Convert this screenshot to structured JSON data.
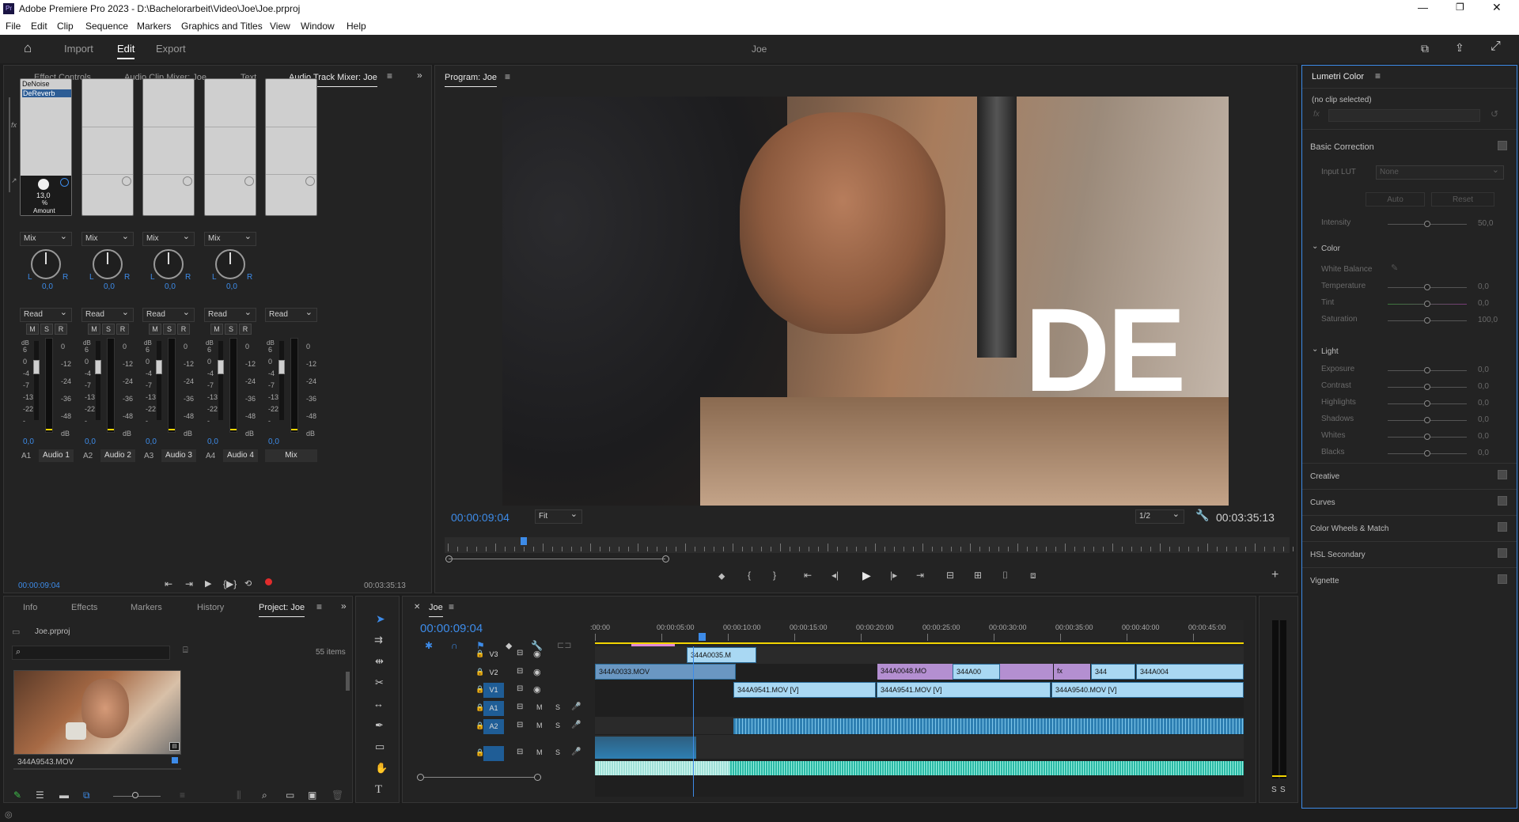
{
  "window": {
    "title": "Adobe Premiere Pro 2023 - D:\\Bachelorarbeit\\Video\\Joe\\Joe.prproj"
  },
  "menu": [
    "File",
    "Edit",
    "Clip",
    "Sequence",
    "Markers",
    "Graphics and Titles",
    "View",
    "Window",
    "Help"
  ],
  "workspace": {
    "tabs": [
      "Import",
      "Edit",
      "Export"
    ],
    "active": "Edit",
    "project_name": "Joe"
  },
  "left_panel": {
    "tabs": [
      "Effect Controls",
      "Audio Clip Mixer: Joe",
      "Text",
      "Audio Track Mixer: Joe"
    ],
    "active": "Audio Track Mixer: Joe"
  },
  "mixer": {
    "effects": [
      "DeNoise",
      "DeReverb"
    ],
    "amount_value": "13,0",
    "amount_unit": "%",
    "amount_label": "Amount",
    "mode_label": "Mix",
    "automation_label": "Read",
    "mute": "M",
    "solo": "S",
    "record": "R",
    "db_label": "dB",
    "left_scale": [
      "6",
      "0",
      "-4",
      "-7",
      "-13",
      "-22",
      "-"
    ],
    "right_scale": [
      "0",
      "-12",
      "-24",
      "-36",
      "-48",
      "dB"
    ],
    "channels": [
      {
        "id": "A1",
        "name": "Audio 1",
        "pan": "0,0",
        "vol": "0,0"
      },
      {
        "id": "A2",
        "name": "Audio 2",
        "pan": "0,0",
        "vol": "0,0"
      },
      {
        "id": "A3",
        "name": "Audio 3",
        "pan": "0,0",
        "vol": "0,0"
      },
      {
        "id": "A4",
        "name": "Audio 4",
        "pan": "0,0",
        "vol": "0,0"
      },
      {
        "id": "",
        "name": "Mix",
        "pan": "",
        "vol": "0,0"
      }
    ],
    "pan_l": "L",
    "pan_r": "R",
    "current_time": "00:00:09:04",
    "duration": "00:03:35:13"
  },
  "program": {
    "title": "Program: Joe",
    "timecode": "00:00:09:04",
    "fit": "Fit",
    "resolution": "1/2",
    "duration": "00:03:35:13",
    "overlay_text": "DE",
    "playhead_fraction": 0.09
  },
  "lumetri": {
    "title": "Lumetri Color",
    "no_clip": "(no clip selected)",
    "fx": "fx",
    "basic_correction": "Basic Correction",
    "input_lut": "Input LUT",
    "lut_value": "None",
    "auto": "Auto",
    "reset": "Reset",
    "intensity": "Intensity",
    "intensity_value": "50,0",
    "color_section": "Color",
    "white_balance": "White Balance",
    "color_rows": [
      {
        "label": "Temperature",
        "value": "0,0"
      },
      {
        "label": "Tint",
        "value": "0,0"
      },
      {
        "label": "Saturation",
        "value": "100,0"
      }
    ],
    "light_section": "Light",
    "light_rows": [
      {
        "label": "Exposure",
        "value": "0,0"
      },
      {
        "label": "Contrast",
        "value": "0,0"
      },
      {
        "label": "Highlights",
        "value": "0,0"
      },
      {
        "label": "Shadows",
        "value": "0,0"
      },
      {
        "label": "Whites",
        "value": "0,0"
      },
      {
        "label": "Blacks",
        "value": "0,0"
      }
    ],
    "sections": [
      "Creative",
      "Curves",
      "Color Wheels & Match",
      "HSL Secondary",
      "Vignette"
    ]
  },
  "project_panel": {
    "tabs": [
      "Info",
      "Effects",
      "Markers",
      "History",
      "Project: Joe"
    ],
    "active": "Project: Joe",
    "file": "Joe.prproj",
    "items": "55 items",
    "clip_name": "344A9543.MOV"
  },
  "timeline": {
    "sequence": "Joe",
    "timecode": "00:00:09:04",
    "ruler": [
      ":00:00",
      "00:00:05:00",
      "00:00:10:00",
      "00:00:15:00",
      "00:00:20:00",
      "00:00:25:00",
      "00:00:30:00",
      "00:00:35:00",
      "00:00:40:00",
      "00:00:45:00"
    ],
    "tracks": [
      {
        "id": "V3",
        "kind": "video"
      },
      {
        "id": "V2",
        "kind": "video"
      },
      {
        "id": "V1",
        "kind": "video"
      },
      {
        "id": "A1",
        "kind": "audio"
      },
      {
        "id": "A2",
        "kind": "audio"
      },
      {
        "id": "",
        "kind": "audio"
      }
    ],
    "clips": {
      "v3": [
        {
          "label": "344A0035.M"
        }
      ],
      "v2": [
        {
          "label": "344A0033.MOV"
        },
        {
          "label": "344A0048.MO"
        },
        {
          "label": "344A00"
        },
        {
          "label": "fx"
        },
        {
          "label": "344"
        },
        {
          "label": "344A004"
        }
      ],
      "v1": [
        {
          "label": "344A9541.MOV [V]"
        },
        {
          "label": "344A9541.MOV [V]"
        },
        {
          "label": "344A9540.MOV [V]"
        }
      ]
    },
    "meter_labels": [
      "S",
      "S"
    ]
  },
  "colors": {
    "accent": "#3d8be8",
    "title_bar": "#ffffff",
    "panel": "#232323",
    "video_clip": "#a9d8f3",
    "audio_clip": "#2e7fb2",
    "music_clip": "#2ab9a6",
    "fx_clip": "#b48fd1",
    "work_area": "#f2d400",
    "marker": "#e08ad6"
  }
}
